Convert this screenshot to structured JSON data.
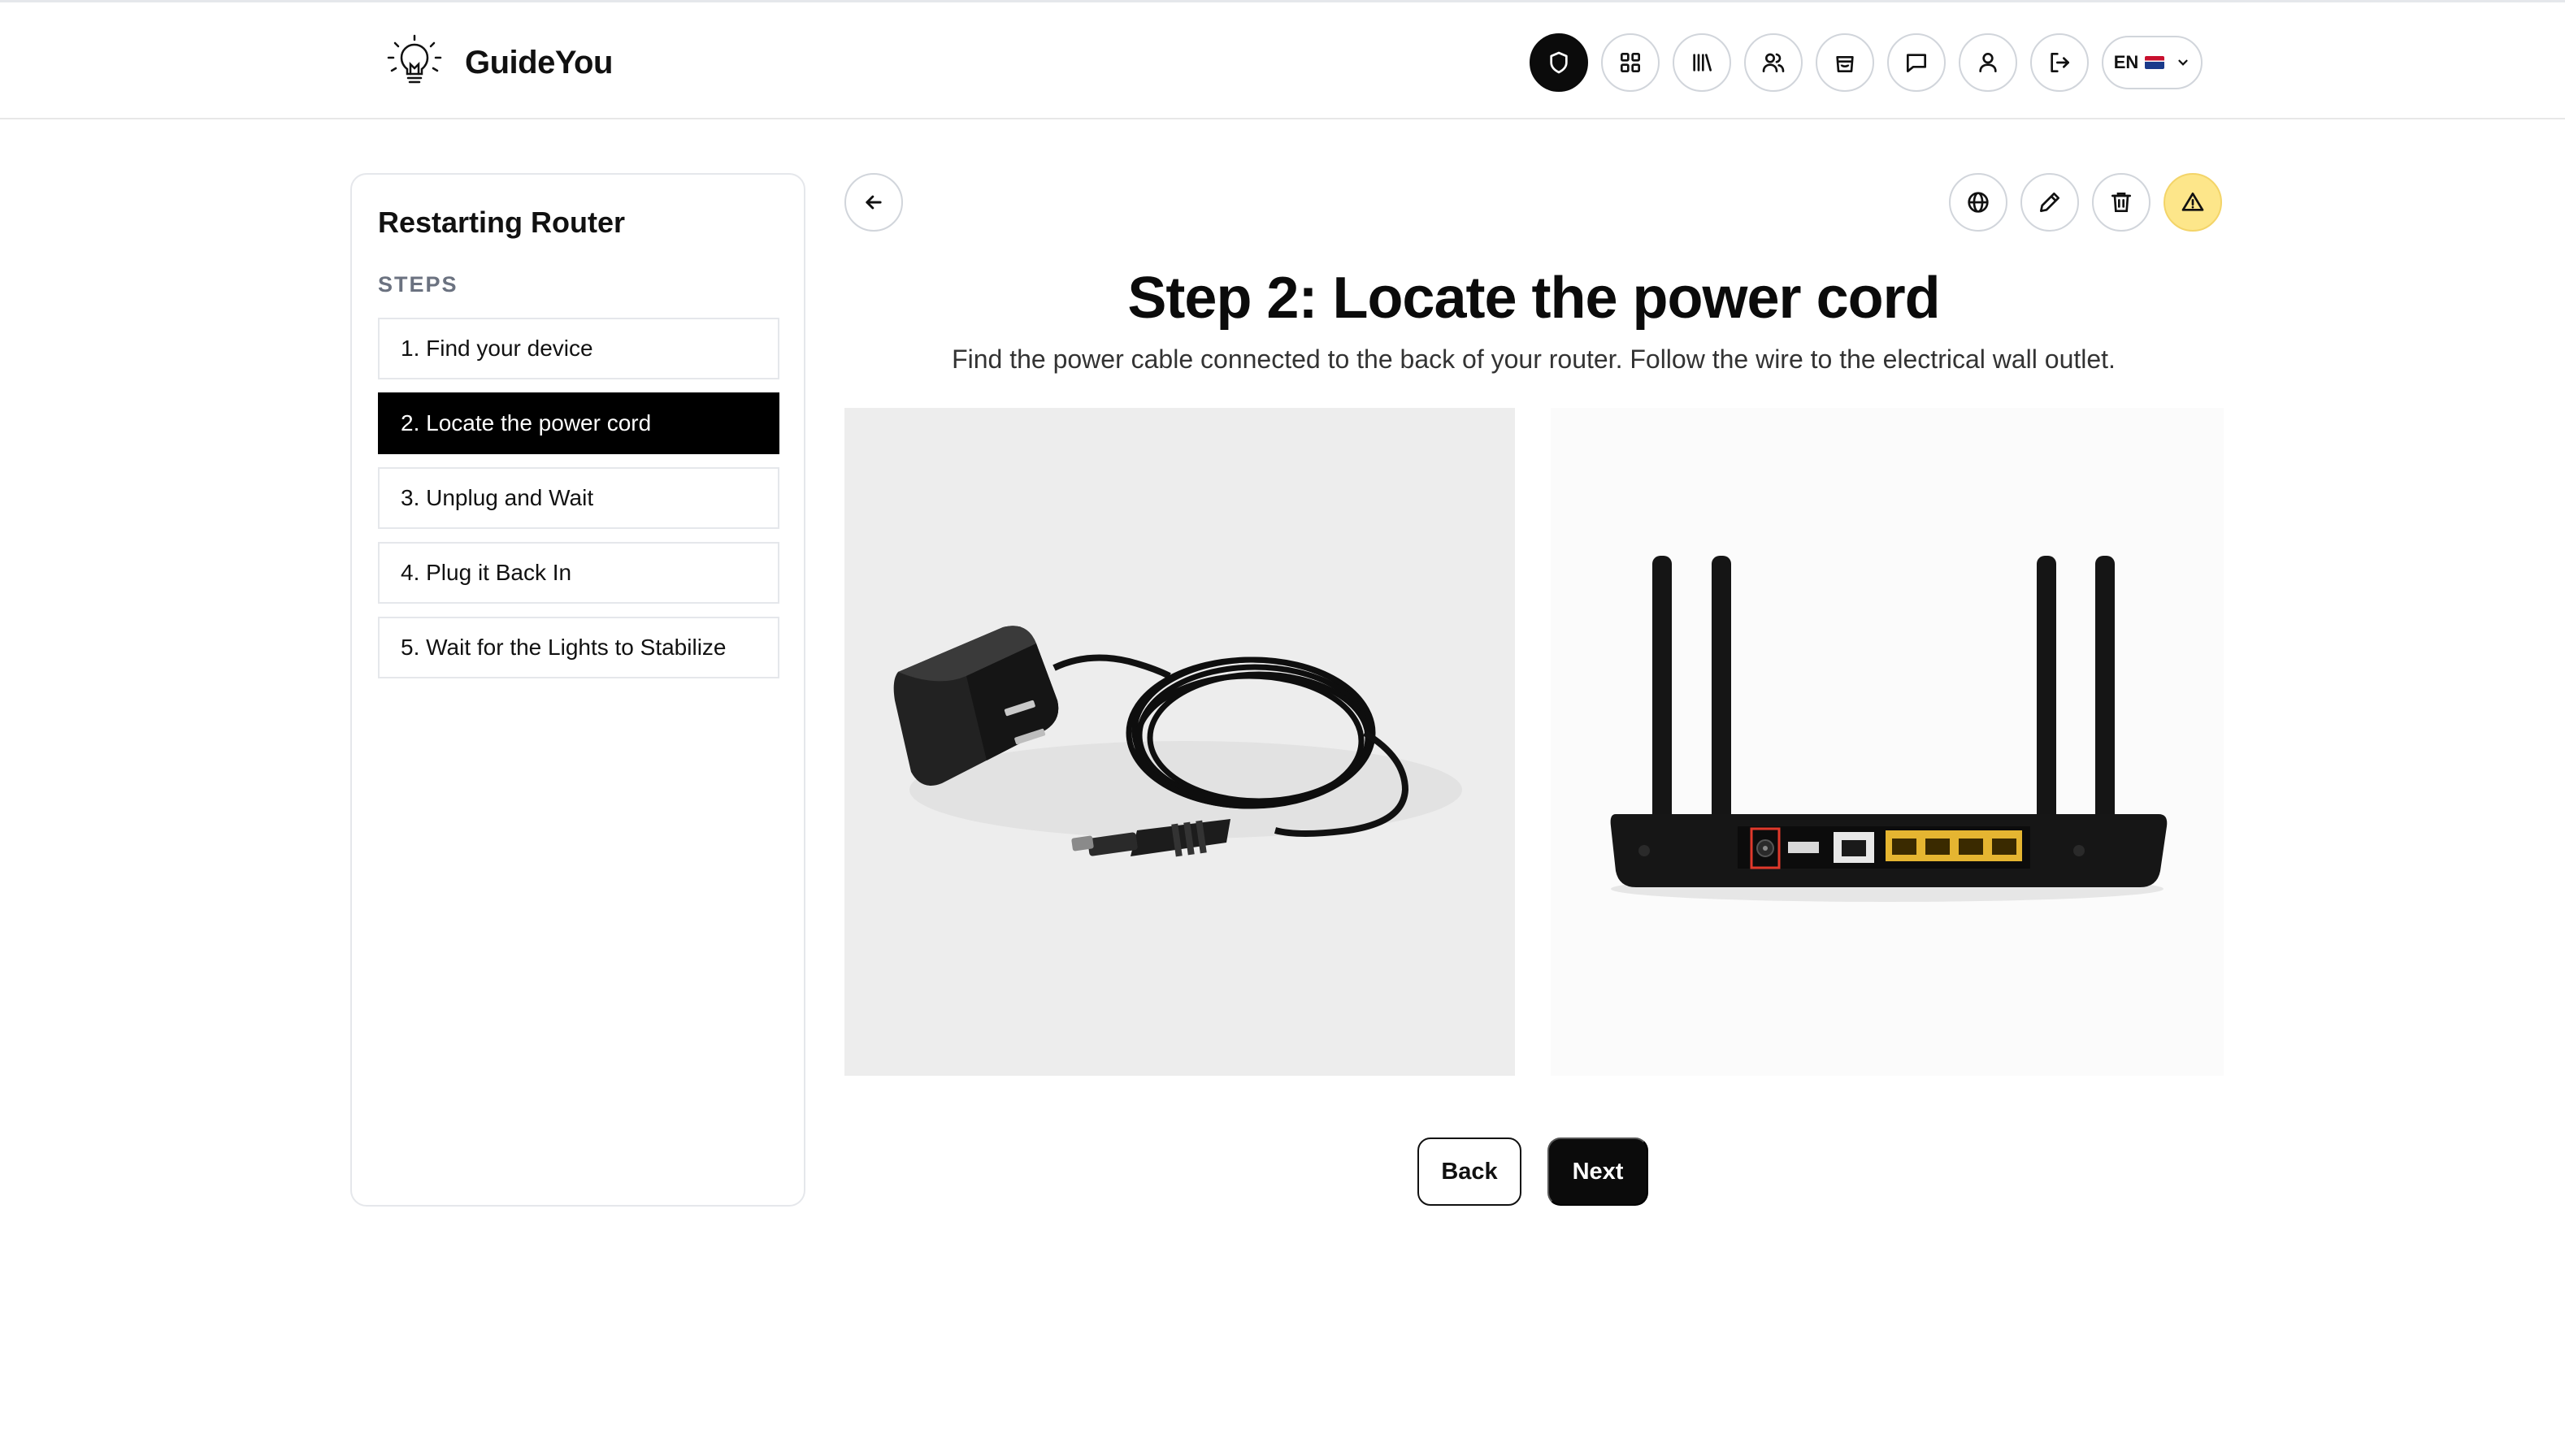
{
  "app": {
    "name": "GuideYou",
    "logo_icon": "lightbulb-icon"
  },
  "nav": {
    "items": [
      {
        "icon": "shield-icon",
        "active": true
      },
      {
        "icon": "grid-icon",
        "active": false
      },
      {
        "icon": "library-icon",
        "active": false
      },
      {
        "icon": "users-icon",
        "active": false
      },
      {
        "icon": "shopping-bag-icon",
        "active": false
      },
      {
        "icon": "chat-icon",
        "active": false
      },
      {
        "icon": "user-icon",
        "active": false
      },
      {
        "icon": "logout-icon",
        "active": false
      }
    ],
    "language": {
      "code": "EN",
      "flag_icon": "uk-flag-icon"
    }
  },
  "sidebar": {
    "title": "Restarting Router",
    "steps_label": "STEPS",
    "steps": [
      {
        "label": "1. Find your device",
        "active": false
      },
      {
        "label": "2. Locate the power cord",
        "active": true
      },
      {
        "label": "3. Unplug and Wait",
        "active": false
      },
      {
        "label": "4. Plug it Back In",
        "active": false
      },
      {
        "label": "5. Wait for the Lights to Stabilize",
        "active": false
      }
    ]
  },
  "toolbar": {
    "icons": [
      "globe-icon",
      "pencil-icon",
      "trash-icon",
      "warning-icon"
    ],
    "warning_color": "#fde68a"
  },
  "main": {
    "title": "Step 2: Locate the power cord",
    "description": "Find the power cable connected to the back of your router. Follow the wire to the electrical wall outlet.",
    "images": [
      "power-adapter-image",
      "router-back-image"
    ]
  },
  "actions": {
    "back_label": "Back",
    "next_label": "Next"
  },
  "colors": {
    "primary": "#0b0b0b",
    "border": "#e5e7eb",
    "muted_text": "#6b7280"
  }
}
